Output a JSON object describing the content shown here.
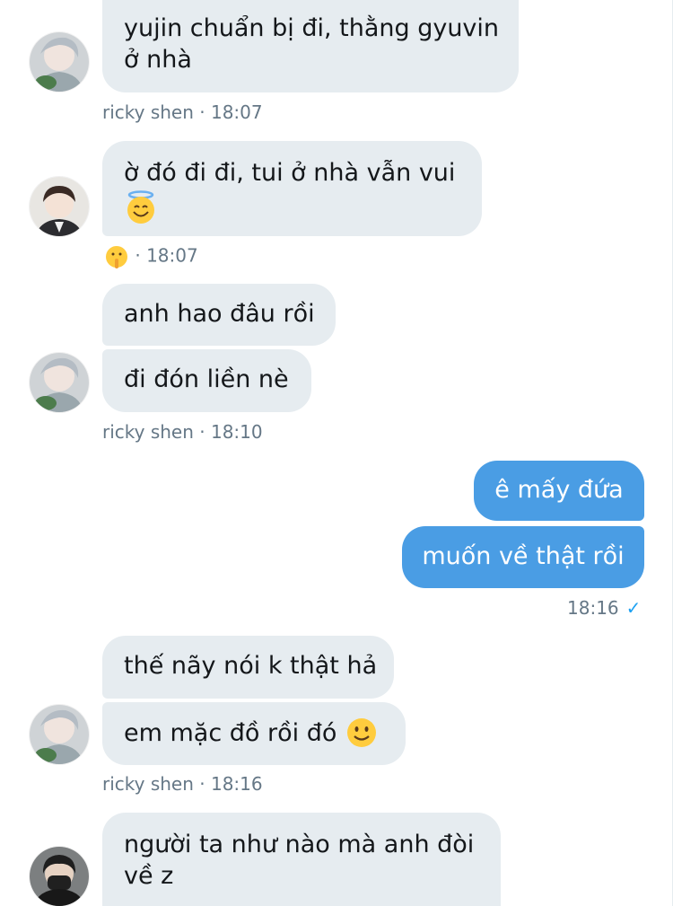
{
  "messages": [
    {
      "sender": "ricky",
      "text": "yujin chuẩn bị đi, thằng gyuvin",
      "text2": "ở nhà"
    },
    {
      "sender": "other1",
      "text": "ờ đó đi đi, tui ở nhà vẫn vui"
    },
    {
      "sender": "ricky",
      "text": "anh hao đâu rồi"
    },
    {
      "sender": "ricky",
      "text": "đi đón liền nè"
    },
    {
      "sender": "me",
      "text": "ê mấy đứa"
    },
    {
      "sender": "me",
      "text": "muốn về thật rồi"
    },
    {
      "sender": "ricky",
      "text": "thế nãy nói k thật hả"
    },
    {
      "sender": "ricky",
      "text": "em mặc đồ rồi đó"
    },
    {
      "sender": "other2",
      "text": "người ta như nào mà anh đòi",
      "text2": "về z"
    }
  ],
  "meta": {
    "m1": "ricky shen · 18:07",
    "m2": "· 18:07",
    "m3": "ricky shen · 18:10",
    "m4": "18:16",
    "m4_check": "✓",
    "m5": "ricky shen · 18:16"
  },
  "icons": {
    "halo_emoji": "smiling-face-with-halo-icon",
    "shush_emoji": "shushing-face-icon",
    "smile_emoji": "slightly-smiling-face-icon",
    "read_check": "check-icon"
  },
  "colors": {
    "incoming_bubble": "#e6ecf0",
    "outgoing_bubble": "#4a9de4",
    "meta_text": "#657786",
    "check": "#1da1f2"
  }
}
